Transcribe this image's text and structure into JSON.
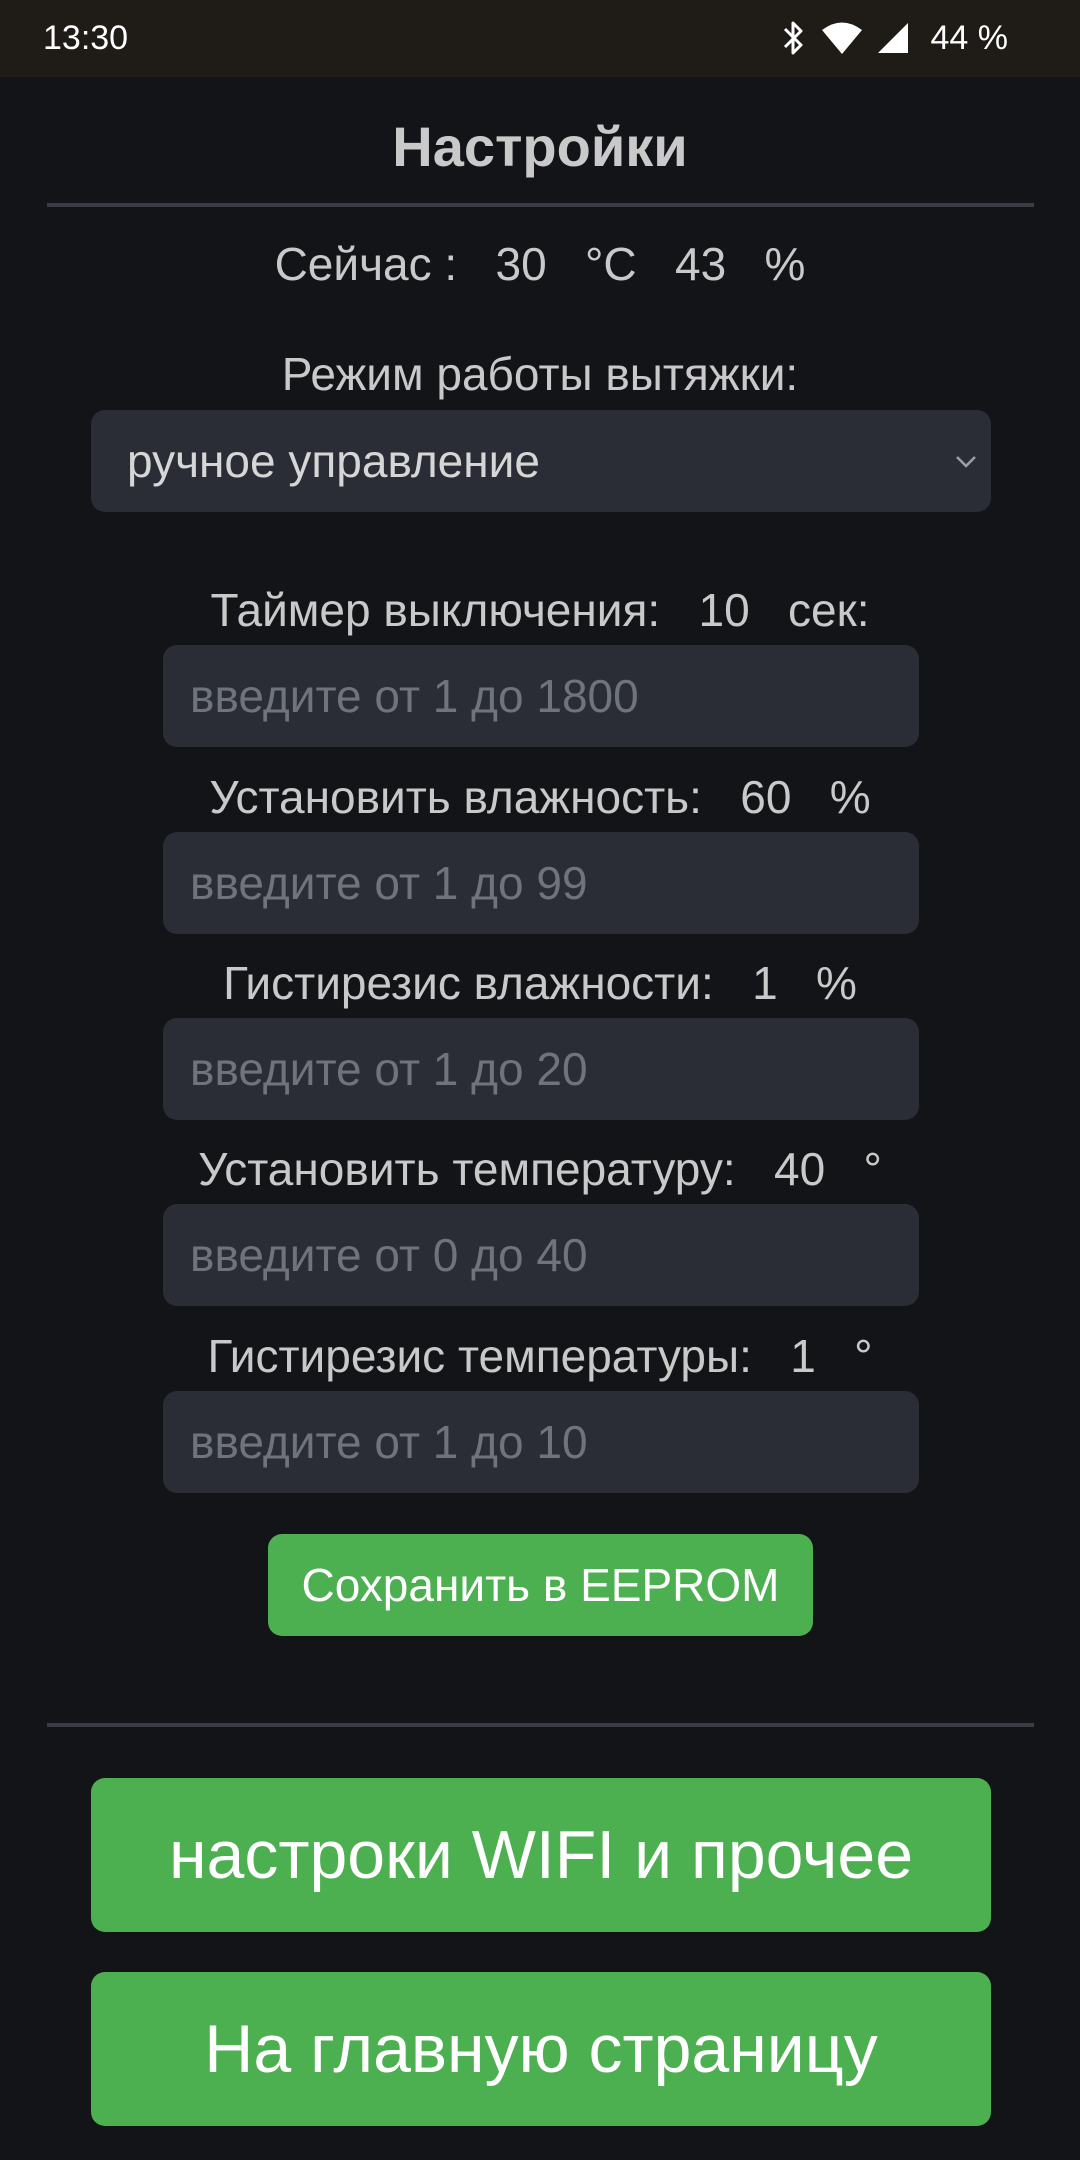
{
  "status_bar": {
    "time": "13:30",
    "battery": "44 %",
    "icons": [
      "bluetooth-icon",
      "wifi-icon",
      "cell-signal-icon"
    ]
  },
  "title": "Настройки",
  "now_line": "Сейчас :   30   °C   43   %",
  "mode": {
    "label": "Режим работы вытяжки:",
    "selected": "ручное управление"
  },
  "fields": [
    {
      "label": "Таймер выключения:   10   сек:",
      "placeholder": "введите от 1 до 1800"
    },
    {
      "label": "Установить влажность:   60   %",
      "placeholder": "введите от 1 до 99"
    },
    {
      "label": "Гистирезис влажности:   1   %",
      "placeholder": "введите от 1 до 20"
    },
    {
      "label": "Установить температуру:   40   °",
      "placeholder": "введите от 0 до 40"
    },
    {
      "label": "Гистирезис температуры:   1   °",
      "placeholder": "введите от 1 до 10"
    }
  ],
  "save_button": "Сохранить в EEPROM",
  "wifi_button": "настроки WIFI и прочее",
  "home_button": "На главную страницу",
  "colors": {
    "background": "#121418",
    "input_bg": "#2a2d36",
    "accent_green": "#4caf50",
    "text": "#c9c9c9"
  }
}
